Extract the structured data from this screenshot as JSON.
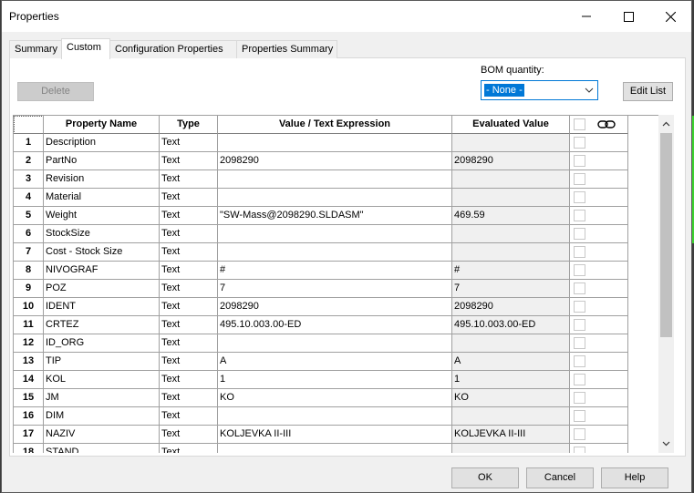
{
  "window": {
    "title": "Properties"
  },
  "tabs": [
    {
      "label": "Summary",
      "active": false
    },
    {
      "label": "Custom",
      "active": true
    },
    {
      "label": "Configuration Properties",
      "active": false
    },
    {
      "label": "Properties Summary",
      "active": false
    }
  ],
  "toolbar": {
    "delete_label": "Delete",
    "bom_label": "BOM quantity:",
    "bom_value": "- None -",
    "edit_list_label": "Edit List"
  },
  "table": {
    "headers": [
      "",
      "Property Name",
      "Type",
      "Value / Text Expression",
      "Evaluated Value",
      "link-icon"
    ],
    "rows": [
      {
        "num": "1",
        "name": "Description",
        "type": "Text",
        "value": "",
        "evaluated": ""
      },
      {
        "num": "2",
        "name": "PartNo",
        "type": "Text",
        "value": "2098290",
        "evaluated": "2098290"
      },
      {
        "num": "3",
        "name": "Revision",
        "type": "Text",
        "value": "",
        "evaluated": ""
      },
      {
        "num": "4",
        "name": "Material",
        "type": "Text",
        "value": "",
        "evaluated": ""
      },
      {
        "num": "5",
        "name": "Weight",
        "type": "Text",
        "value": "\"SW-Mass@2098290.SLDASM\"",
        "evaluated": "469.59"
      },
      {
        "num": "6",
        "name": "StockSize",
        "type": "Text",
        "value": "",
        "evaluated": ""
      },
      {
        "num": "7",
        "name": "Cost - Stock Size",
        "type": "Text",
        "value": "",
        "evaluated": ""
      },
      {
        "num": "8",
        "name": "NIVOGRAF",
        "type": "Text",
        "value": "#",
        "evaluated": "#"
      },
      {
        "num": "9",
        "name": "POZ",
        "type": "Text",
        "value": "7",
        "evaluated": "7"
      },
      {
        "num": "10",
        "name": "IDENT",
        "type": "Text",
        "value": "2098290",
        "evaluated": "2098290"
      },
      {
        "num": "11",
        "name": "CRTEZ",
        "type": "Text",
        "value": "495.10.003.00-ED",
        "evaluated": "495.10.003.00-ED"
      },
      {
        "num": "12",
        "name": "ID_ORG",
        "type": "Text",
        "value": "",
        "evaluated": ""
      },
      {
        "num": "13",
        "name": "TIP",
        "type": "Text",
        "value": "A",
        "evaluated": "A"
      },
      {
        "num": "14",
        "name": "KOL",
        "type": "Text",
        "value": "1",
        "evaluated": "1"
      },
      {
        "num": "15",
        "name": "JM",
        "type": "Text",
        "value": "KO",
        "evaluated": "KO"
      },
      {
        "num": "16",
        "name": "DIM",
        "type": "Text",
        "value": "",
        "evaluated": ""
      },
      {
        "num": "17",
        "name": "NAZIV",
        "type": "Text",
        "value": "KOLJEVKA II-III",
        "evaluated": "KOLJEVKA II-III"
      },
      {
        "num": "18",
        "name": "STAND",
        "type": "Text",
        "value": "",
        "evaluated": ""
      }
    ]
  },
  "buttons": {
    "ok": "OK",
    "cancel": "Cancel",
    "help": "Help"
  },
  "colors": {
    "selection": "#0078d7",
    "evaluated_bg": "#f0f0f0",
    "background_model": "#3bd22e"
  }
}
